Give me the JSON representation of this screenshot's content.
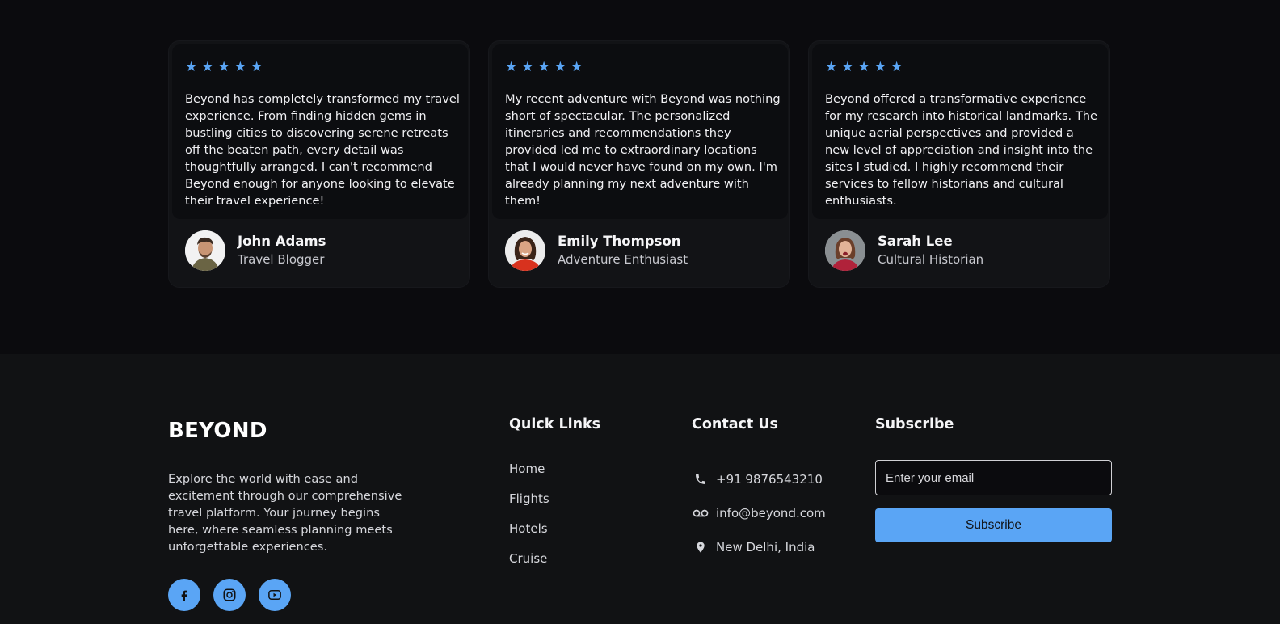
{
  "testimonials": [
    {
      "rating": 5,
      "text": "Beyond has completely transformed my travel experience. From finding hidden gems in bustling cities to discovering serene retreats off the beaten path, every detail was thoughtfully arranged. I can't recommend Beyond enough for anyone looking to elevate their travel experience!",
      "name": "John Adams",
      "role": "Travel Blogger"
    },
    {
      "rating": 5,
      "text": "My recent adventure with Beyond was nothing short of spectacular. The personalized itineraries and recommendations they provided led me to extraordinary locations that I would never have found on my own. I'm already planning my next adventure with them!",
      "name": "Emily Thompson",
      "role": "Adventure Enthusiast"
    },
    {
      "rating": 5,
      "text": "Beyond offered a transformative experience for my research into historical landmarks. The unique aerial perspectives and provided a new level of appreciation and insight into the sites I studied. I highly recommend their services to fellow historians and cultural enthusiasts.",
      "name": "Sarah Lee",
      "role": "Cultural Historian"
    }
  ],
  "footer": {
    "brand": "BEYOND",
    "about": "Explore the world with ease and excitement through our comprehensive travel platform. Your journey begins here, where seamless planning meets unforgettable experiences.",
    "socials": [
      "facebook-icon",
      "instagram-icon",
      "youtube-icon"
    ],
    "quick_links_title": "Quick Links",
    "quick_links": [
      "Home",
      "Flights",
      "Hotels",
      "Cruise"
    ],
    "contact_title": "Contact Us",
    "contact": {
      "phone": "+91 9876543210",
      "email": "info@beyond.com",
      "location": "New Delhi, India"
    },
    "subscribe_title": "Subscribe",
    "email_placeholder": "Enter your email",
    "subscribe_label": "Subscribe"
  },
  "colors": {
    "accent": "#5aa5f5",
    "page_bg": "#0b0b0e",
    "footer_bg": "#111214"
  }
}
